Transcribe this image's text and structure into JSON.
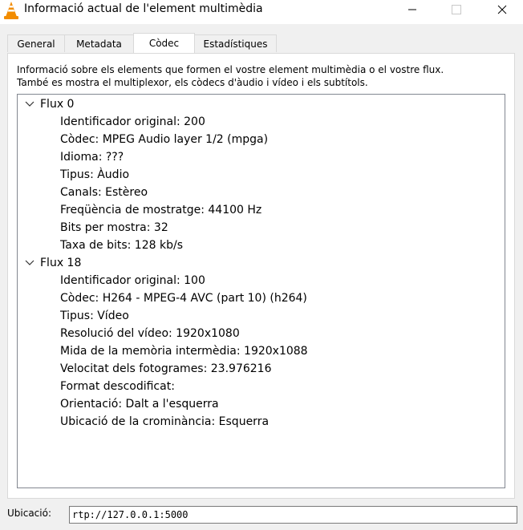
{
  "window": {
    "title": "Informació actual de l'element multimèdia",
    "icon": "vlc-cone-icon"
  },
  "tabs": [
    {
      "label": "General"
    },
    {
      "label": "Metadata"
    },
    {
      "label": "Còdec",
      "active": true
    },
    {
      "label": "Estadístiques"
    }
  ],
  "description": {
    "line1": "Informació sobre els elements que formen el vostre element multimèdia o el vostre flux.",
    "line2": "També es mostra el multiplexor, els còdecs d'àudio i vídeo i els subtítols."
  },
  "streams": [
    {
      "label": "Flux 0",
      "expanded": true,
      "props": [
        "Identificador original: 200",
        "Còdec: MPEG Audio layer 1/2 (mpga)",
        "Idioma: ???",
        "Tipus: Àudio",
        "Canals: Estèreo",
        "Freqüència de mostratge: 44100 Hz",
        "Bits per mostra: 32",
        "Taxa de bits: 128 kb/s"
      ]
    },
    {
      "label": "Flux 18",
      "expanded": true,
      "props": [
        "Identificador original: 100",
        "Còdec: H264 - MPEG-4 AVC (part 10) (h264)",
        "Tipus: Vídeo",
        "Resolució del vídeo: 1920x1080",
        "Mida de la memòria intermèdia: 1920x1088",
        "Velocitat dels fotogrames: 23.976216",
        "Format descodificat:",
        "Orientació: Dalt a l'esquerra",
        "Ubicació de la crominància: Esquerra"
      ]
    }
  ],
  "location": {
    "label": "Ubicació:",
    "value": "rtp://127.0.0.1:5000"
  },
  "colors": {
    "vlc_orange": "#f28c00",
    "border": "#d9d9d9",
    "tree_border": "#828790"
  }
}
